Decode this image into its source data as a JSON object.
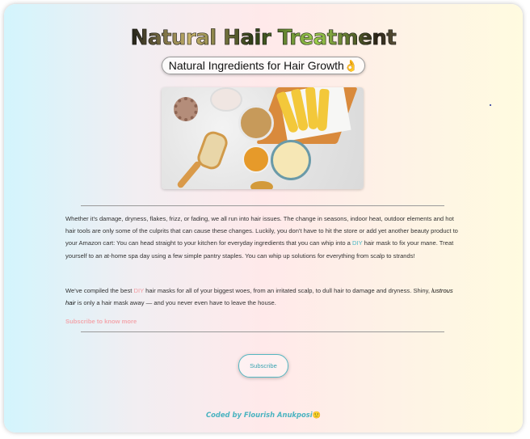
{
  "header": {
    "title": "Natural Hair Treatment",
    "subtitle": "Natural Ingredients for Hair Growth",
    "subtitle_emoji": "👌"
  },
  "hero": {
    "image_alt": "Bananas, honey, oats, scrunchie and hairbrush on marble"
  },
  "article": {
    "p1_part1": "Whether it's damage, dryness, flakes, frizz, or fading, we all run into hair issues. The change in seasons, indoor heat, outdoor elements and hot hair tools are only some of the culprits that can cause these changes. Luckily, you don't have to hit the store or add yet another beauty product to your Amazon cart: You can head straight to your kitchen for everyday ingredients that you can whip into a ",
    "p1_highlight": "DIY",
    "p1_part2": " hair mask to fix your mane. Treat yourself to an at-home spa day using a few simple pantry staples. You can whip up solutions for everything from scalp to strands!",
    "p2_part1": "We've compiled the best ",
    "p2_highlight": "DIY",
    "p2_part2": " hair masks for all of your biggest woes, from an irritated scalp, to dull hair to damage and dryness. Shiny, ",
    "p2_italic": "lustrous hair",
    "p2_part3": " is only a hair mask away — and you never even have to leave the house.",
    "subscribe_link": "Subscribe to know more"
  },
  "subscribe_button": "Subscribe",
  "footer": {
    "credit": "Coded by Flourish Anukposi",
    "emoji": "🙂"
  },
  "colors": {
    "accent_teal": "#4ab8c6",
    "accent_pink": "#f29aa0"
  }
}
